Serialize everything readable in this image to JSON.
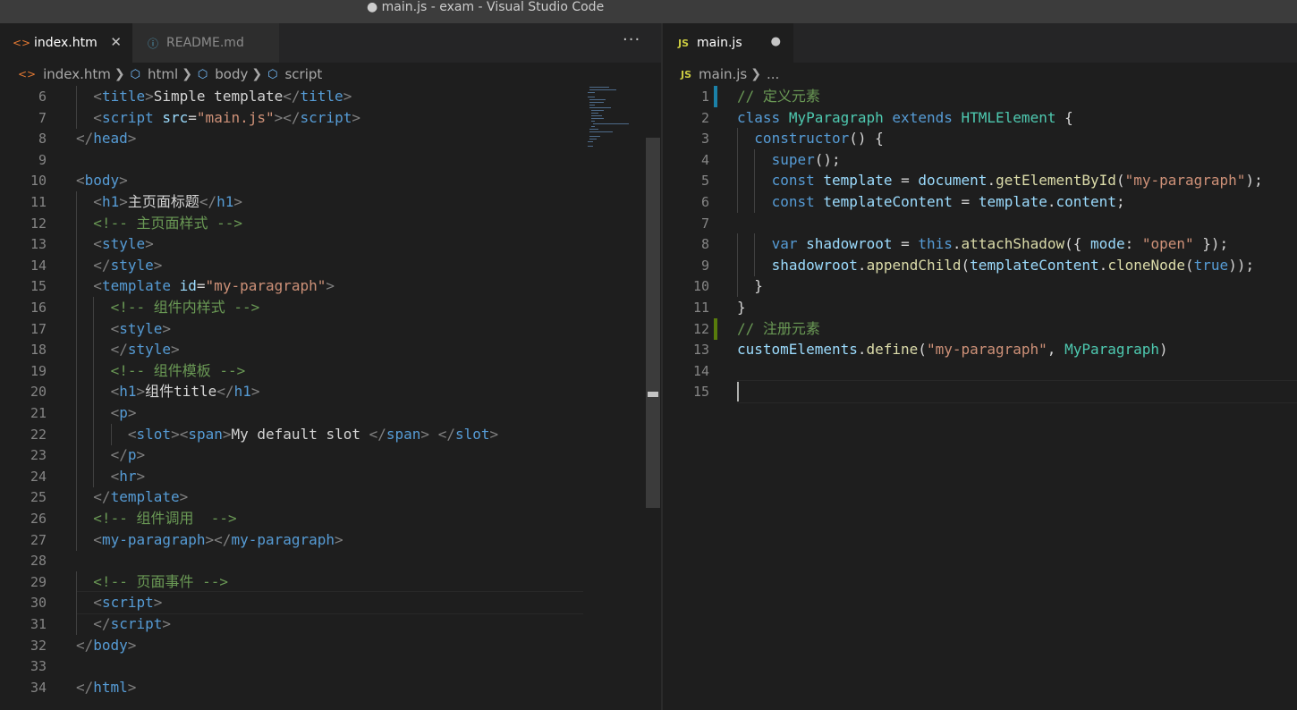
{
  "window": {
    "title": "● main.js - exam - Visual Studio Code"
  },
  "left": {
    "tabs": [
      {
        "icon": "<>",
        "label": "index.htm",
        "close": "✕"
      },
      {
        "icon": "ⓘ",
        "label": "README.md"
      }
    ],
    "more": "···",
    "breadcrumb": {
      "file_icon": "<>",
      "file": "index.htm",
      "items": [
        "html",
        "body",
        "script"
      ]
    },
    "lines": [
      {
        "n": "6",
        "ind": 1,
        "tokens": [
          [
            "t",
            "<"
          ],
          [
            "n",
            "title"
          ],
          [
            "t",
            ">"
          ],
          [
            "p",
            "Simple template"
          ],
          [
            "t",
            "</"
          ],
          [
            "n",
            "title"
          ],
          [
            "t",
            ">"
          ]
        ]
      },
      {
        "n": "7",
        "ind": 1,
        "tokens": [
          [
            "t",
            "<"
          ],
          [
            "n",
            "script"
          ],
          [
            "p",
            " "
          ],
          [
            "a",
            "src"
          ],
          [
            "p",
            "="
          ],
          [
            "s",
            "\"main.js\""
          ],
          [
            "t",
            "></"
          ],
          [
            "n",
            "script"
          ],
          [
            "t",
            ">"
          ]
        ]
      },
      {
        "n": "8",
        "ind": 0,
        "tokens": [
          [
            "t",
            "</"
          ],
          [
            "n",
            "head"
          ],
          [
            "t",
            ">"
          ]
        ]
      },
      {
        "n": "9",
        "ind": 0,
        "tokens": []
      },
      {
        "n": "10",
        "ind": 0,
        "tokens": [
          [
            "t",
            "<"
          ],
          [
            "n",
            "body"
          ],
          [
            "t",
            ">"
          ]
        ]
      },
      {
        "n": "11",
        "ind": 1,
        "tokens": [
          [
            "t",
            "<"
          ],
          [
            "n",
            "h1"
          ],
          [
            "t",
            ">"
          ],
          [
            "p",
            "主页面标题"
          ],
          [
            "t",
            "</"
          ],
          [
            "n",
            "h1"
          ],
          [
            "t",
            ">"
          ]
        ]
      },
      {
        "n": "12",
        "ind": 1,
        "tokens": [
          [
            "c",
            "<!-- 主页面样式 -->"
          ]
        ]
      },
      {
        "n": "13",
        "ind": 1,
        "tokens": [
          [
            "t",
            "<"
          ],
          [
            "n",
            "style"
          ],
          [
            "t",
            ">"
          ]
        ]
      },
      {
        "n": "14",
        "ind": 1,
        "tokens": [
          [
            "t",
            "</"
          ],
          [
            "n",
            "style"
          ],
          [
            "t",
            ">"
          ]
        ]
      },
      {
        "n": "15",
        "ind": 1,
        "tokens": [
          [
            "t",
            "<"
          ],
          [
            "n",
            "template"
          ],
          [
            "p",
            " "
          ],
          [
            "a",
            "id"
          ],
          [
            "p",
            "="
          ],
          [
            "s",
            "\"my-paragraph\""
          ],
          [
            "t",
            ">"
          ]
        ]
      },
      {
        "n": "16",
        "ind": 2,
        "tokens": [
          [
            "c",
            "<!-- 组件内样式 -->"
          ]
        ]
      },
      {
        "n": "17",
        "ind": 2,
        "tokens": [
          [
            "t",
            "<"
          ],
          [
            "n",
            "style"
          ],
          [
            "t",
            ">"
          ]
        ]
      },
      {
        "n": "18",
        "ind": 2,
        "tokens": [
          [
            "t",
            "</"
          ],
          [
            "n",
            "style"
          ],
          [
            "t",
            ">"
          ]
        ]
      },
      {
        "n": "19",
        "ind": 2,
        "tokens": [
          [
            "c",
            "<!-- 组件模板 -->"
          ]
        ]
      },
      {
        "n": "20",
        "ind": 2,
        "tokens": [
          [
            "t",
            "<"
          ],
          [
            "n",
            "h1"
          ],
          [
            "t",
            ">"
          ],
          [
            "p",
            "组件title"
          ],
          [
            "t",
            "</"
          ],
          [
            "n",
            "h1"
          ],
          [
            "t",
            ">"
          ]
        ]
      },
      {
        "n": "21",
        "ind": 2,
        "tokens": [
          [
            "t",
            "<"
          ],
          [
            "n",
            "p"
          ],
          [
            "t",
            ">"
          ]
        ]
      },
      {
        "n": "22",
        "ind": 3,
        "tokens": [
          [
            "t",
            "<"
          ],
          [
            "n",
            "slot"
          ],
          [
            "t",
            "><"
          ],
          [
            "n",
            "span"
          ],
          [
            "t",
            ">"
          ],
          [
            "p",
            "My default slot "
          ],
          [
            "t",
            "</"
          ],
          [
            "n",
            "span"
          ],
          [
            "t",
            ">"
          ],
          [
            "p",
            " "
          ],
          [
            "t",
            "</"
          ],
          [
            "n",
            "slot"
          ],
          [
            "t",
            ">"
          ]
        ]
      },
      {
        "n": "23",
        "ind": 2,
        "tokens": [
          [
            "t",
            "</"
          ],
          [
            "n",
            "p"
          ],
          [
            "t",
            ">"
          ]
        ]
      },
      {
        "n": "24",
        "ind": 2,
        "tokens": [
          [
            "t",
            "<"
          ],
          [
            "n",
            "hr"
          ],
          [
            "t",
            ">"
          ]
        ]
      },
      {
        "n": "25",
        "ind": 1,
        "tokens": [
          [
            "t",
            "</"
          ],
          [
            "n",
            "template"
          ],
          [
            "t",
            ">"
          ]
        ]
      },
      {
        "n": "26",
        "ind": 1,
        "tokens": [
          [
            "c",
            "<!-- 组件调用  -->"
          ]
        ]
      },
      {
        "n": "27",
        "ind": 1,
        "tokens": [
          [
            "t",
            "<"
          ],
          [
            "n",
            "my-paragraph"
          ],
          [
            "t",
            "></"
          ],
          [
            "n",
            "my-paragraph"
          ],
          [
            "t",
            ">"
          ]
        ]
      },
      {
        "n": "28",
        "ind": 0,
        "tokens": []
      },
      {
        "n": "29",
        "ind": 1,
        "tokens": [
          [
            "c",
            "<!-- 页面事件 -->"
          ]
        ]
      },
      {
        "n": "30",
        "ind": 1,
        "tokens": [
          [
            "t",
            "<"
          ],
          [
            "n",
            "script"
          ],
          [
            "t",
            ">"
          ]
        ]
      },
      {
        "n": "31",
        "ind": 1,
        "tokens": [
          [
            "t",
            "</"
          ],
          [
            "n",
            "script"
          ],
          [
            "t",
            ">"
          ]
        ]
      },
      {
        "n": "32",
        "ind": 0,
        "tokens": [
          [
            "t",
            "</"
          ],
          [
            "n",
            "body"
          ],
          [
            "t",
            ">"
          ]
        ]
      },
      {
        "n": "33",
        "ind": 0,
        "tokens": []
      },
      {
        "n": "34",
        "ind": 0,
        "tokens": [
          [
            "t",
            "</"
          ],
          [
            "n",
            "html"
          ],
          [
            "t",
            ">"
          ]
        ]
      }
    ]
  },
  "right": {
    "tabs": [
      {
        "icon": "JS",
        "label": "main.js",
        "dirty": "●"
      }
    ],
    "breadcrumb": {
      "file_icon": "JS",
      "file": "main.js",
      "items": [
        "..."
      ]
    },
    "lines": [
      {
        "n": "1",
        "ind": 0,
        "tokens": [
          [
            "c",
            "// 定义元素"
          ]
        ]
      },
      {
        "n": "2",
        "ind": 0,
        "tokens": [
          [
            "k",
            "class"
          ],
          [
            "p",
            " "
          ],
          [
            "cl",
            "MyParagraph"
          ],
          [
            "p",
            " "
          ],
          [
            "k",
            "extends"
          ],
          [
            "p",
            " "
          ],
          [
            "cl",
            "HTMLElement"
          ],
          [
            "p",
            " {"
          ]
        ]
      },
      {
        "n": "3",
        "ind": 1,
        "tokens": [
          [
            "k",
            "constructor"
          ],
          [
            "p",
            "() {"
          ]
        ]
      },
      {
        "n": "4",
        "ind": 2,
        "tokens": [
          [
            "k",
            "super"
          ],
          [
            "p",
            "();"
          ]
        ]
      },
      {
        "n": "5",
        "ind": 2,
        "tokens": [
          [
            "k",
            "const"
          ],
          [
            "p",
            " "
          ],
          [
            "v",
            "template"
          ],
          [
            "p",
            " = "
          ],
          [
            "v",
            "document"
          ],
          [
            "p",
            "."
          ],
          [
            "f",
            "getElementById"
          ],
          [
            "p",
            "("
          ],
          [
            "s",
            "\"my-paragraph\""
          ],
          [
            "p",
            ");"
          ]
        ]
      },
      {
        "n": "6",
        "ind": 2,
        "tokens": [
          [
            "k",
            "const"
          ],
          [
            "p",
            " "
          ],
          [
            "v",
            "templateContent"
          ],
          [
            "p",
            " = "
          ],
          [
            "v",
            "template"
          ],
          [
            "p",
            "."
          ],
          [
            "v",
            "content"
          ],
          [
            "p",
            ";"
          ]
        ]
      },
      {
        "n": "7",
        "ind": 0,
        "tokens": []
      },
      {
        "n": "8",
        "ind": 2,
        "tokens": [
          [
            "k",
            "var"
          ],
          [
            "p",
            " "
          ],
          [
            "v",
            "shadowroot"
          ],
          [
            "p",
            " = "
          ],
          [
            "k",
            "this"
          ],
          [
            "p",
            "."
          ],
          [
            "f",
            "attachShadow"
          ],
          [
            "p",
            "({ "
          ],
          [
            "v",
            "mode"
          ],
          [
            "p",
            ": "
          ],
          [
            "s",
            "\"open\""
          ],
          [
            "p",
            " });"
          ]
        ]
      },
      {
        "n": "9",
        "ind": 2,
        "tokens": [
          [
            "v",
            "shadowroot"
          ],
          [
            "p",
            "."
          ],
          [
            "f",
            "appendChild"
          ],
          [
            "p",
            "("
          ],
          [
            "v",
            "templateContent"
          ],
          [
            "p",
            "."
          ],
          [
            "f",
            "cloneNode"
          ],
          [
            "p",
            "("
          ],
          [
            "k",
            "true"
          ],
          [
            "p",
            "));"
          ]
        ]
      },
      {
        "n": "10",
        "ind": 1,
        "tokens": [
          [
            "p",
            "}"
          ]
        ]
      },
      {
        "n": "11",
        "ind": 0,
        "tokens": [
          [
            "p",
            "}"
          ]
        ]
      },
      {
        "n": "12",
        "ind": 0,
        "tokens": [
          [
            "c",
            "// 注册元素"
          ]
        ]
      },
      {
        "n": "13",
        "ind": 0,
        "tokens": [
          [
            "v",
            "customElements"
          ],
          [
            "p",
            "."
          ],
          [
            "f",
            "define"
          ],
          [
            "p",
            "("
          ],
          [
            "s",
            "\"my-paragraph\""
          ],
          [
            "p",
            ", "
          ],
          [
            "cl",
            "MyParagraph"
          ],
          [
            "p",
            ")"
          ]
        ]
      },
      {
        "n": "14",
        "ind": 0,
        "tokens": []
      },
      {
        "n": "15",
        "ind": 0,
        "tokens": []
      }
    ]
  },
  "colors": {
    "accent_left_tab_icon": "#e37933",
    "js_icon": "#cbcb41",
    "git_modified": "#1b81a8",
    "git_added": "#587c0c"
  }
}
